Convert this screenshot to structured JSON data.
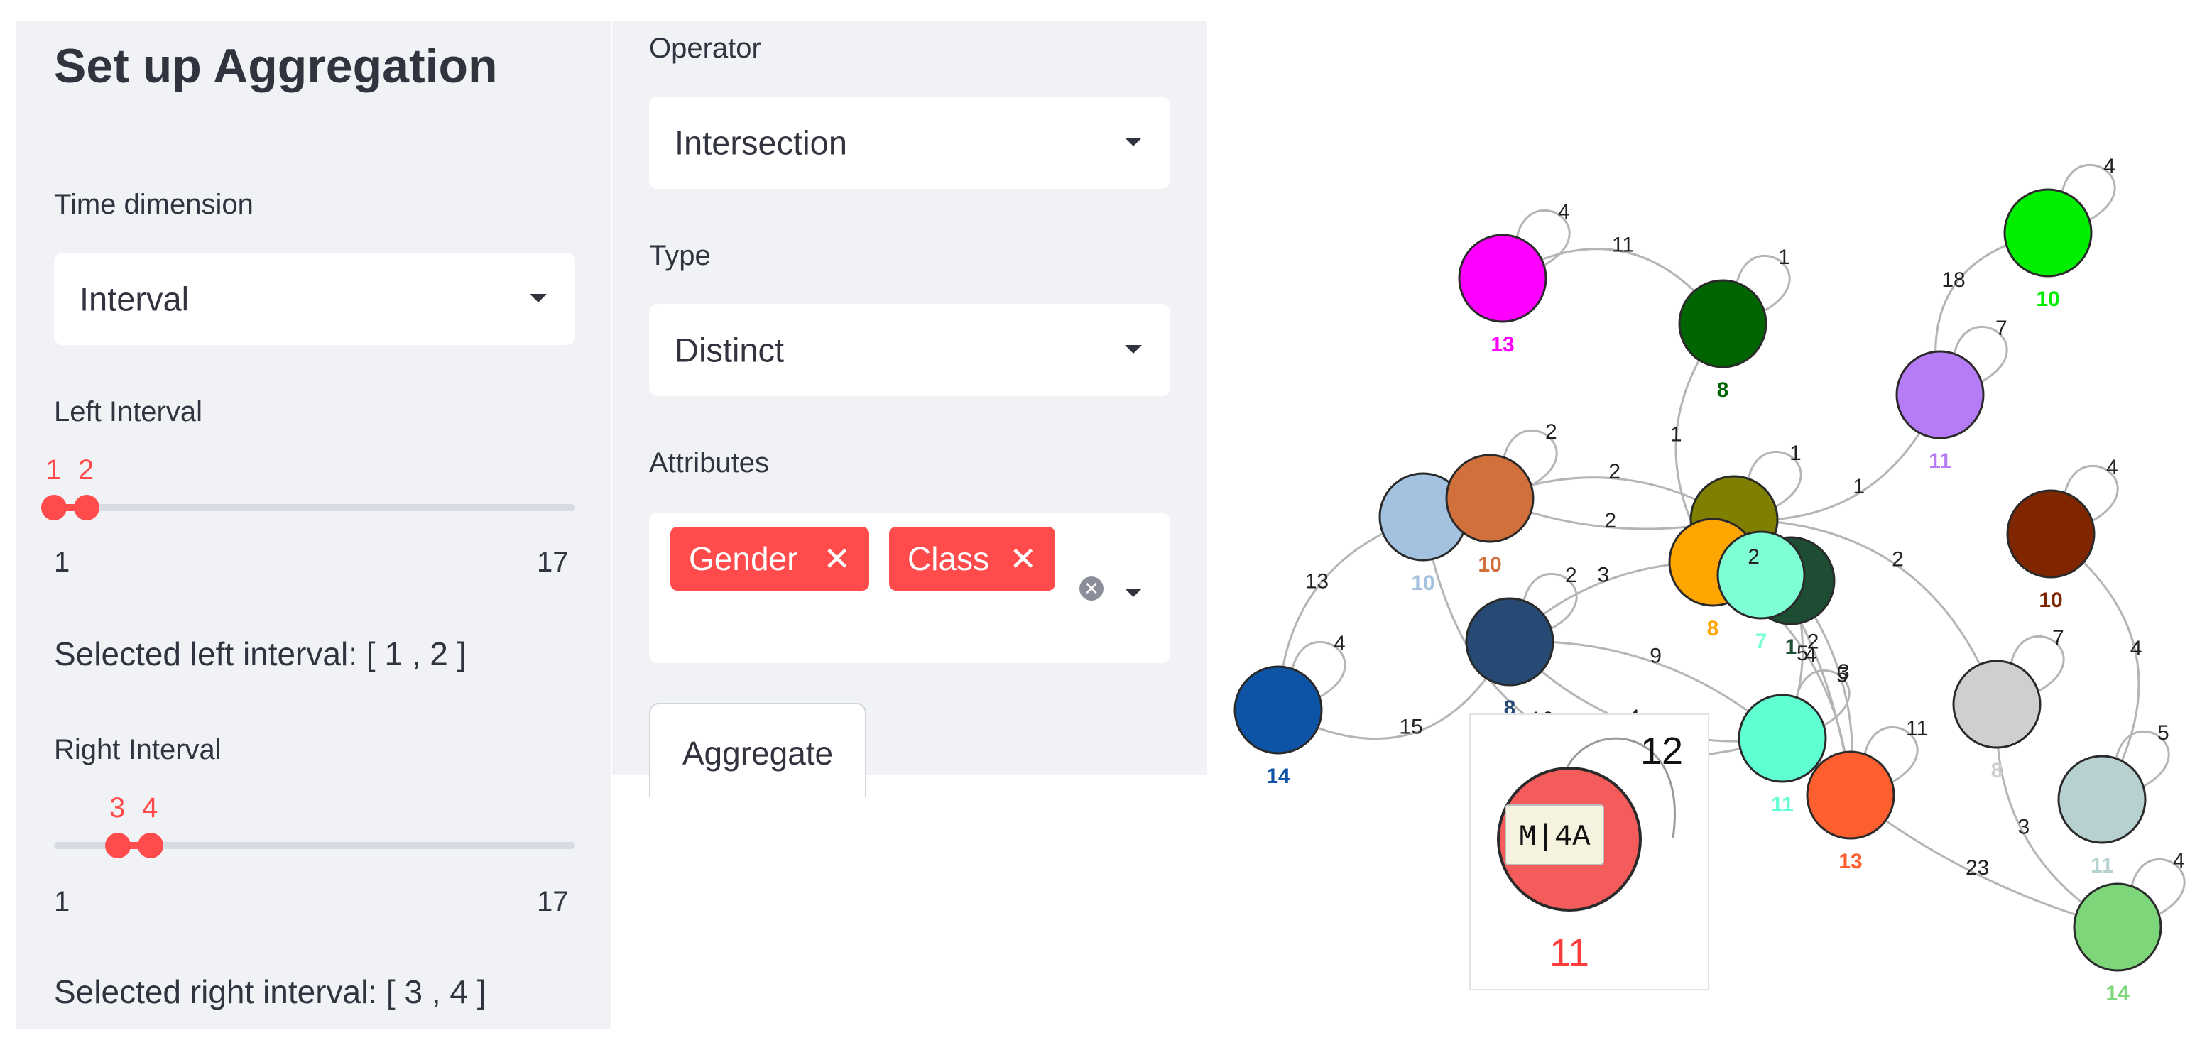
{
  "sidebar": {
    "title": "Set up Aggregation",
    "time_dimension": {
      "label": "Time dimension",
      "value": "Interval"
    },
    "left_interval": {
      "label": "Left Interval",
      "lo": "1",
      "hi": "2",
      "min": "1",
      "max": "17",
      "selected_text": "Selected left interval: [ 1 , 2 ]"
    },
    "right_interval": {
      "label": "Right Interval",
      "lo": "3",
      "hi": "4",
      "min": "1",
      "max": "17",
      "selected_text": "Selected right interval: [ 3 , 4 ]"
    }
  },
  "settings": {
    "operator": {
      "label": "Operator",
      "value": "Intersection"
    },
    "type": {
      "label": "Type",
      "value": "Distinct"
    },
    "attributes": {
      "label": "Attributes",
      "chips": [
        "Gender",
        "Class"
      ],
      "remove_glyph": "✕",
      "clear_glyph": "✕"
    },
    "aggregate_button": "Aggregate"
  },
  "graph": {
    "edge_color": "#b5b5b5",
    "nodes": [
      {
        "id": "magenta",
        "color": "#ff00ff",
        "label": "13",
        "self_loop": "4"
      },
      {
        "id": "darkgreen",
        "color": "#006400",
        "label": "8",
        "self_loop": "1"
      },
      {
        "id": "lime",
        "color": "#00ee00",
        "label": "10",
        "self_loop": "4"
      },
      {
        "id": "lavender",
        "color": "#b57cf5",
        "label": "11",
        "self_loop": "7"
      },
      {
        "id": "lightsteel",
        "color": "#a3c2e0",
        "label": "10",
        "self_loop": ""
      },
      {
        "id": "copper",
        "color": "#d2703c",
        "label": "10",
        "self_loop": "2"
      },
      {
        "id": "olive",
        "color": "#7f7f00",
        "label": "",
        "self_loop": "1"
      },
      {
        "id": "orange",
        "color": "#ffa500",
        "label": "8",
        "self_loop": ""
      },
      {
        "id": "forest",
        "color": "#1d4d33",
        "label": "1",
        "self_loop": ""
      },
      {
        "id": "aquamarine",
        "color": "#7fffd4",
        "label": "7",
        "self_loop": ""
      },
      {
        "id": "maroon",
        "color": "#7f2600",
        "label": "10",
        "self_loop": "4"
      },
      {
        "id": "navy",
        "color": "#264a73",
        "label": "8",
        "self_loop": "2"
      },
      {
        "id": "blue",
        "color": "#0d53a6",
        "label": "14",
        "self_loop": "4"
      },
      {
        "id": "mint",
        "color": "#5fffd1",
        "label": "11",
        "self_loop": "3"
      },
      {
        "id": "tomato",
        "color": "#ff5f2e",
        "label": "13",
        "self_loop": "11"
      },
      {
        "id": "grey",
        "color": "#cfcfcf",
        "label": "8",
        "self_loop": "7"
      },
      {
        "id": "ashgreen",
        "color": "#b7d1d1",
        "label": "11",
        "self_loop": "5"
      },
      {
        "id": "lightgreen",
        "color": "#7ed67b",
        "label": "14",
        "self_loop": "4"
      }
    ],
    "edge_labels": [
      "11",
      "18",
      "1",
      "2",
      "1",
      "2",
      "13",
      "2",
      "2",
      "5",
      "4",
      "3",
      "4",
      "16",
      "15",
      "2",
      "5",
      "9",
      "23",
      "3",
      "4"
    ],
    "tooltip": {
      "node_label": "11",
      "loop_label": "12",
      "tag": "M|4A",
      "color": "#f45b5b",
      "label_color": "#ff3c3c"
    }
  }
}
